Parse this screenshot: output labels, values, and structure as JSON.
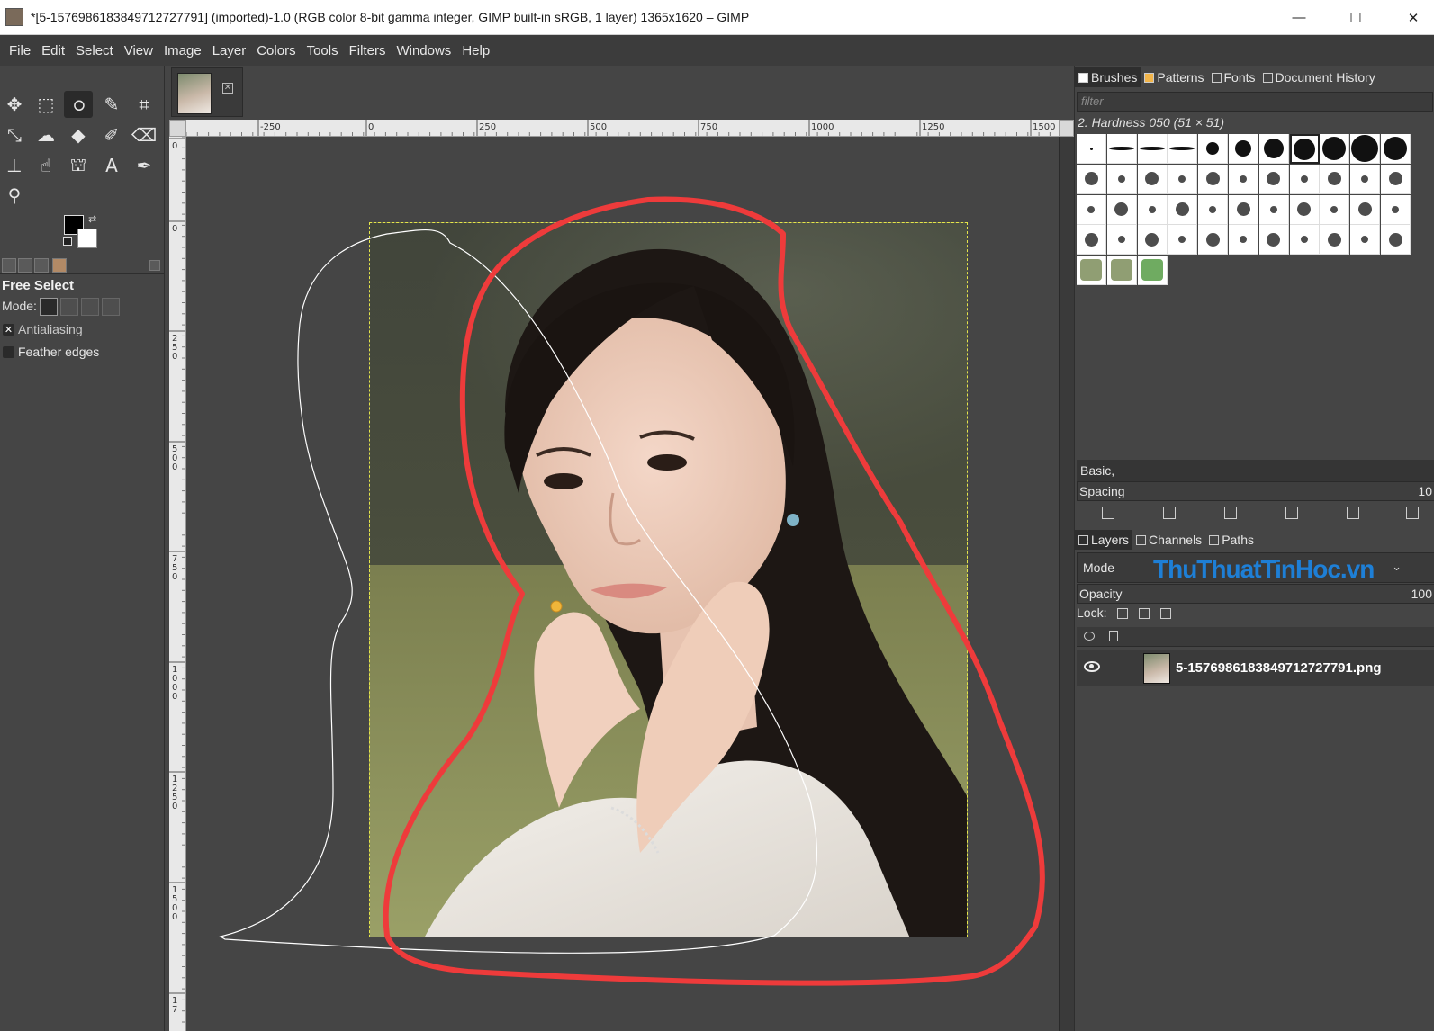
{
  "window": {
    "title": "*[5-1576986183849712727791] (imported)-1.0 (RGB color 8-bit gamma integer, GIMP built-in sRGB, 1 layer) 1365x1620 – GIMP",
    "minimize_label": "—",
    "maximize_label": "☐",
    "close_label": "✕"
  },
  "menu": [
    "File",
    "Edit",
    "Select",
    "View",
    "Image",
    "Layer",
    "Colors",
    "Tools",
    "Filters",
    "Windows",
    "Help"
  ],
  "toolbox": {
    "tools": [
      {
        "name": "move-tool",
        "glyph": "✥"
      },
      {
        "name": "rect-select-tool",
        "glyph": "⬚"
      },
      {
        "name": "free-select-tool",
        "glyph": "ഠ"
      },
      {
        "name": "fuzzy-select-tool",
        "glyph": "✎"
      },
      {
        "name": "crop-tool",
        "glyph": "⌗"
      },
      {
        "name": "unified-transform-tool",
        "glyph": "⤡"
      },
      {
        "name": "warp-transform-tool",
        "glyph": "☁"
      },
      {
        "name": "bucket-fill-tool",
        "glyph": "◆"
      },
      {
        "name": "paintbrush-tool",
        "glyph": "✐"
      },
      {
        "name": "eraser-tool",
        "glyph": "⌫"
      },
      {
        "name": "clone-tool",
        "glyph": "⊥"
      },
      {
        "name": "smudge-tool",
        "glyph": "☝"
      },
      {
        "name": "paths-tool",
        "glyph": "⛫"
      },
      {
        "name": "text-tool",
        "glyph": "A"
      },
      {
        "name": "color-picker-tool",
        "glyph": "✒"
      },
      {
        "name": "zoom-tool",
        "glyph": "⚲"
      }
    ],
    "tool_options": {
      "title": "Free Select",
      "mode_label": "Mode:",
      "antialiasing_label": "Antialiasing",
      "antialiasing_checked": true,
      "feather_label": "Feather edges",
      "feather_checked": false
    }
  },
  "canvas": {
    "ruler_h_labels": [
      "-250",
      "0",
      "250",
      "500",
      "750",
      "1000",
      "1250",
      "1500"
    ],
    "ruler_v_labels": [
      "0",
      "0",
      "250",
      "500",
      "750",
      "1000",
      "1250",
      "1500",
      "17"
    ]
  },
  "brushes_panel": {
    "tabs": [
      "Brushes",
      "Patterns",
      "Fonts",
      "Document History"
    ],
    "filter_placeholder": "filter",
    "selected_brush": "2. Hardness 050 (51 × 51)",
    "preset": "Basic,",
    "spacing_label": "Spacing",
    "spacing_value": "10"
  },
  "layers_panel": {
    "tabs": [
      "Layers",
      "Channels",
      "Paths"
    ],
    "mode_label": "Mode",
    "watermark": "ThuThuatTinHoc.vn",
    "opacity_label": "Opacity",
    "opacity_value": "100",
    "lock_label": "Lock:",
    "layers": [
      {
        "name": "5-1576986183849712727791.png",
        "visible": true
      }
    ]
  },
  "colors": {
    "accent_red": "#ee3b3b",
    "selection_handle": "#f0b63a",
    "marching_ants": "#e6e64a"
  }
}
